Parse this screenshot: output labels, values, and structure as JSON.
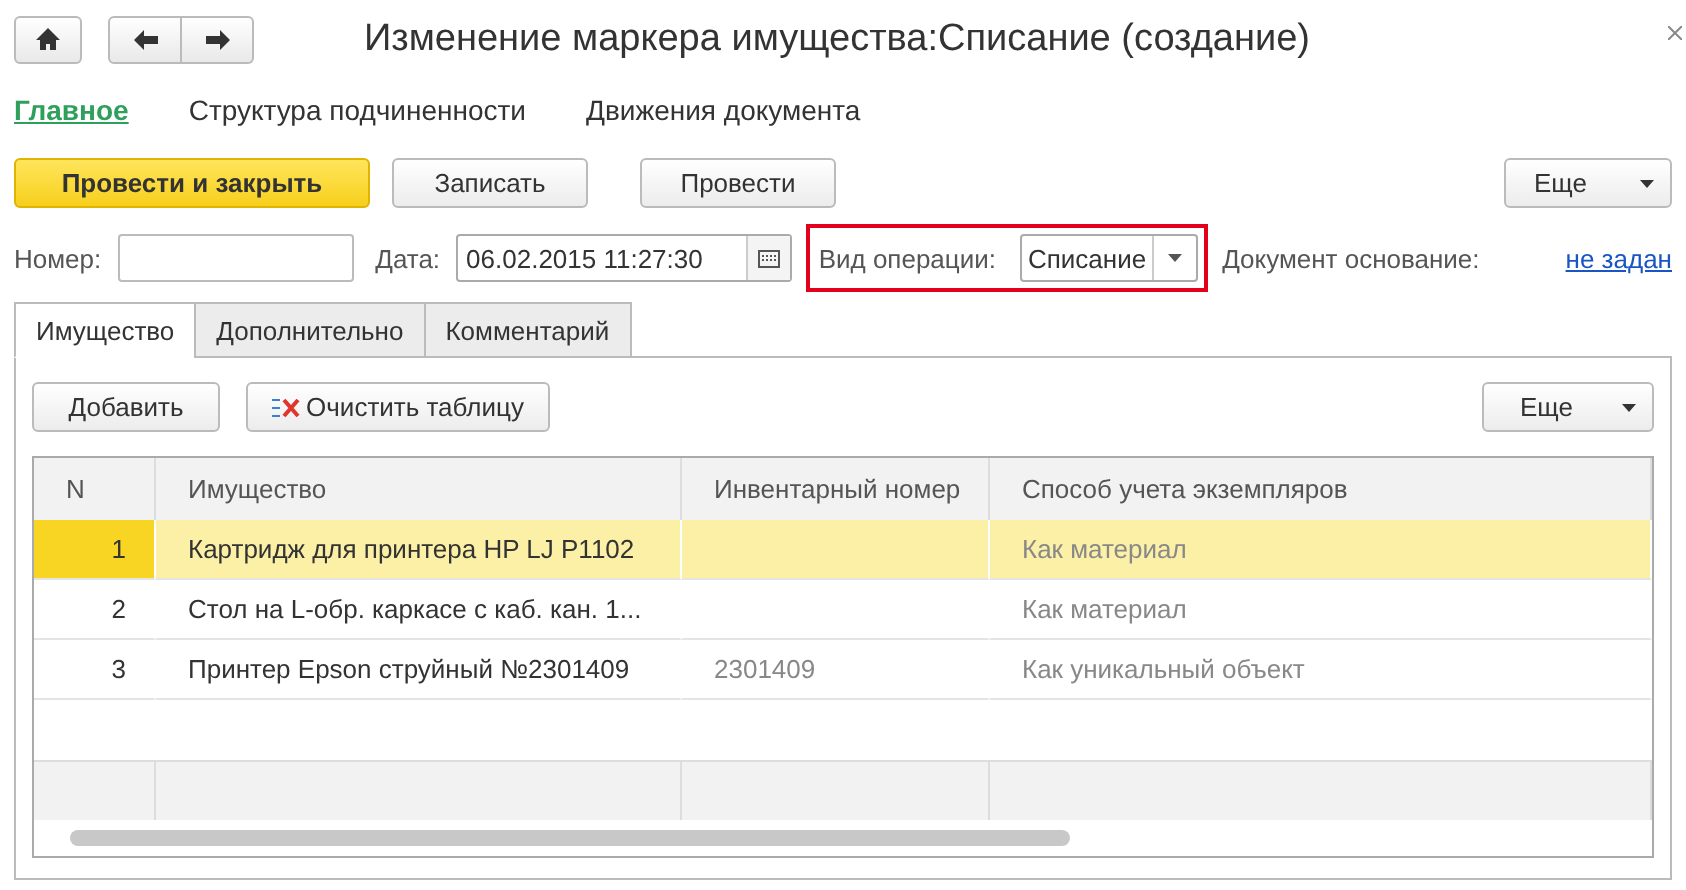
{
  "window": {
    "title": "Изменение маркера имущества:Списание (создание)"
  },
  "sections": [
    {
      "label": "Главное",
      "selected": true
    },
    {
      "label": "Структура подчиненности",
      "selected": false
    },
    {
      "label": "Движения документа",
      "selected": false
    }
  ],
  "command_bar": {
    "buttons": [
      {
        "label": "Провести и закрыть",
        "kind": "primary"
      },
      {
        "label": "Записать",
        "kind": "default"
      },
      {
        "label": "Провести",
        "kind": "default"
      }
    ],
    "more": "Еще"
  },
  "header_fields": {
    "number": {
      "label": "Номер:"
    },
    "date": {
      "label": "Дата:",
      "value": "06.02.2015 11:27:30"
    },
    "operation": {
      "label": "Вид операции:",
      "value": "Списание",
      "highlighted": true
    },
    "basis": {
      "label": "Документ основание:",
      "link": "не задан"
    }
  },
  "tabs": [
    {
      "label": "Имущество",
      "selected": true
    },
    {
      "label": "Дополнительно",
      "selected": false
    },
    {
      "label": "Комментарий",
      "selected": false
    }
  ],
  "table_toolbar": {
    "add": "Добавить",
    "clear": "Очистить таблицу",
    "more": "Еще"
  },
  "table": {
    "columns": [
      "N",
      "Имущество",
      "Инвентарный номер",
      "Способ учета экземпляров"
    ],
    "rows": [
      {
        "n": "1",
        "item": "Картридж для принтера HP LJ P1102",
        "accounting": "Как материал",
        "selected": true
      },
      {
        "n": "2",
        "item": "Стол на L-обр. каркасе с каб. кан. 1...",
        "accounting": "Как материал",
        "selected": false
      },
      {
        "n": "3",
        "item": "Принтер Epson струйный №2301409",
        "inventory_number": "2301409",
        "accounting": "Как уникальный объект",
        "selected": false
      }
    ]
  }
}
